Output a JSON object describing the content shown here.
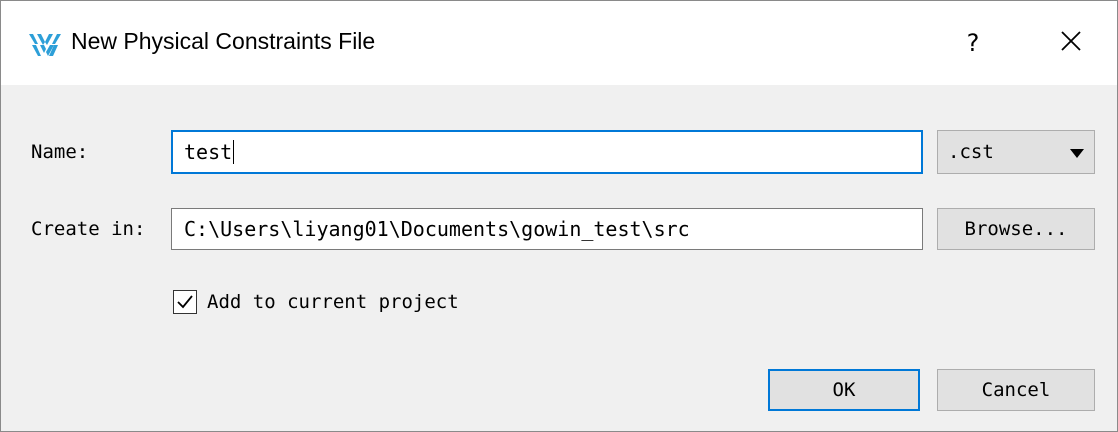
{
  "window": {
    "title": "New Physical Constraints File",
    "help_label": "?",
    "logo_icon": "gowin-logo-icon",
    "close_icon": "close-icon"
  },
  "form": {
    "name_label": "Name:",
    "name_value": "test",
    "extension_selected": ".cst",
    "create_in_label": "Create in:",
    "create_in_value": "C:\\Users\\liyang01\\Documents\\gowin_test\\src",
    "browse_label": "Browse...",
    "add_to_project_label": "Add to current project",
    "add_to_project_checked": true
  },
  "buttons": {
    "ok_label": "OK",
    "cancel_label": "Cancel"
  },
  "colors": {
    "accent": "#0078d7",
    "logo": "#2d9fd8",
    "dialog_bg": "#f0f0f0",
    "button_bg": "#e1e1e1"
  }
}
